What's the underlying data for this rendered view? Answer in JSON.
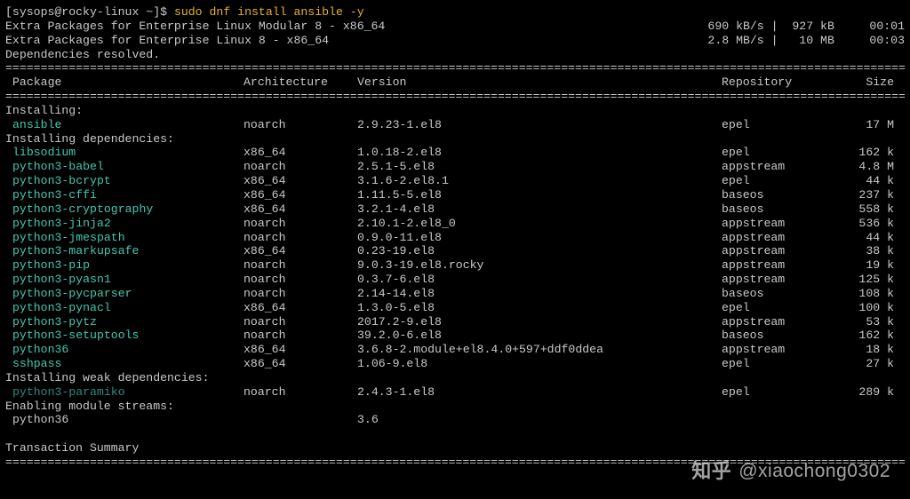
{
  "prompt": {
    "userhost": "[sysops@rocky-linux ~]$ ",
    "command_highlight": "sudo dnf install ansible -y"
  },
  "repo_lines": [
    {
      "name": "Extra Packages for Enterprise Linux Modular 8 - x86_64",
      "speed": "690 kB/s",
      "size": "927 kB",
      "time": "00:01"
    },
    {
      "name": "Extra Packages for Enterprise Linux 8 - x86_64",
      "speed": "2.8 MB/s",
      "size": "10 MB",
      "time": "00:03"
    }
  ],
  "deps_resolved": "Dependencies resolved.",
  "headers": {
    "pkg": "Package",
    "arch": "Architecture",
    "ver": "Version",
    "repo": "Repository",
    "size": "Size"
  },
  "sections": {
    "installing": "Installing:",
    "installing_deps": "Installing dependencies:",
    "installing_weak": "Installing weak dependencies:",
    "enabling_streams": "Enabling module streams:",
    "txn_summary": "Transaction Summary"
  },
  "install_main": [
    {
      "pkg": "ansible",
      "arch": "noarch",
      "ver": "2.9.23-1.el8",
      "repo": "epel",
      "size": "17 M"
    }
  ],
  "install_deps": [
    {
      "pkg": "libsodium",
      "arch": "x86_64",
      "ver": "1.0.18-2.el8",
      "repo": "epel",
      "size": "162 k"
    },
    {
      "pkg": "python3-babel",
      "arch": "noarch",
      "ver": "2.5.1-5.el8",
      "repo": "appstream",
      "size": "4.8 M"
    },
    {
      "pkg": "python3-bcrypt",
      "arch": "x86_64",
      "ver": "3.1.6-2.el8.1",
      "repo": "epel",
      "size": "44 k"
    },
    {
      "pkg": "python3-cffi",
      "arch": "x86_64",
      "ver": "1.11.5-5.el8",
      "repo": "baseos",
      "size": "237 k"
    },
    {
      "pkg": "python3-cryptography",
      "arch": "x86_64",
      "ver": "3.2.1-4.el8",
      "repo": "baseos",
      "size": "558 k"
    },
    {
      "pkg": "python3-jinja2",
      "arch": "noarch",
      "ver": "2.10.1-2.el8_0",
      "repo": "appstream",
      "size": "536 k"
    },
    {
      "pkg": "python3-jmespath",
      "arch": "noarch",
      "ver": "0.9.0-11.el8",
      "repo": "appstream",
      "size": "44 k"
    },
    {
      "pkg": "python3-markupsafe",
      "arch": "x86_64",
      "ver": "0.23-19.el8",
      "repo": "appstream",
      "size": "38 k"
    },
    {
      "pkg": "python3-pip",
      "arch": "noarch",
      "ver": "9.0.3-19.el8.rocky",
      "repo": "appstream",
      "size": "19 k"
    },
    {
      "pkg": "python3-pyasn1",
      "arch": "noarch",
      "ver": "0.3.7-6.el8",
      "repo": "appstream",
      "size": "125 k"
    },
    {
      "pkg": "python3-pycparser",
      "arch": "noarch",
      "ver": "2.14-14.el8",
      "repo": "baseos",
      "size": "108 k"
    },
    {
      "pkg": "python3-pynacl",
      "arch": "x86_64",
      "ver": "1.3.0-5.el8",
      "repo": "epel",
      "size": "100 k"
    },
    {
      "pkg": "python3-pytz",
      "arch": "noarch",
      "ver": "2017.2-9.el8",
      "repo": "appstream",
      "size": "53 k"
    },
    {
      "pkg": "python3-setuptools",
      "arch": "noarch",
      "ver": "39.2.0-6.el8",
      "repo": "baseos",
      "size": "162 k"
    },
    {
      "pkg": "python36",
      "arch": "x86_64",
      "ver": "3.6.8-2.module+el8.4.0+597+ddf0ddea",
      "repo": "appstream",
      "size": "18 k"
    },
    {
      "pkg": "sshpass",
      "arch": "x86_64",
      "ver": "1.06-9.el8",
      "repo": "epel",
      "size": "27 k"
    }
  ],
  "install_weak": [
    {
      "pkg": "python3-paramiko",
      "arch": "noarch",
      "ver": "2.4.3-1.el8",
      "repo": "epel",
      "size": "289 k"
    }
  ],
  "module_streams": [
    {
      "pkg": "python36",
      "ver": "3.6"
    }
  ],
  "watermark": {
    "logo": "知乎",
    "handle": "@xiaochong0302"
  },
  "rule_char": "="
}
